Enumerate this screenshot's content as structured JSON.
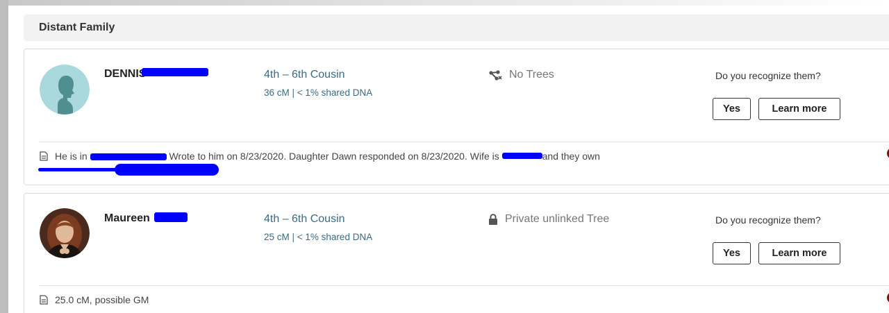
{
  "section": {
    "title": "Distant Family"
  },
  "matches": [
    {
      "name": "DENNIS",
      "relationship": "4th – 6th Cousin",
      "dna": "36 cM | < 1% shared DNA",
      "tree_status": "No Trees",
      "tree_icon": "no-trees-icon",
      "prompt": "Do you recognize them?",
      "yes_label": "Yes",
      "learn_label": "Learn more",
      "note": {
        "part1": "He is in",
        "part2": "Wrote to him on 8/23/2020. Daughter Dawn responded on 8/23/2020. Wife is",
        "part3": "and they own"
      },
      "note_icon": "note-icon"
    },
    {
      "name": "Maureen",
      "relationship": "4th – 6th Cousin",
      "dna": "25 cM | < 1% shared DNA",
      "tree_status": "Private unlinked Tree",
      "tree_icon": "lock-icon",
      "prompt": "Do you recognize them?",
      "yes_label": "Yes",
      "learn_label": "Learn more",
      "note": {
        "text": "25.0 cM, possible GM"
      },
      "note_icon": "note-icon"
    }
  ],
  "colors": {
    "link": "#3a6b86",
    "redaction": "#0000ff",
    "status_dot": "#7a1010",
    "avatar_bg": "#a9d9dc"
  }
}
